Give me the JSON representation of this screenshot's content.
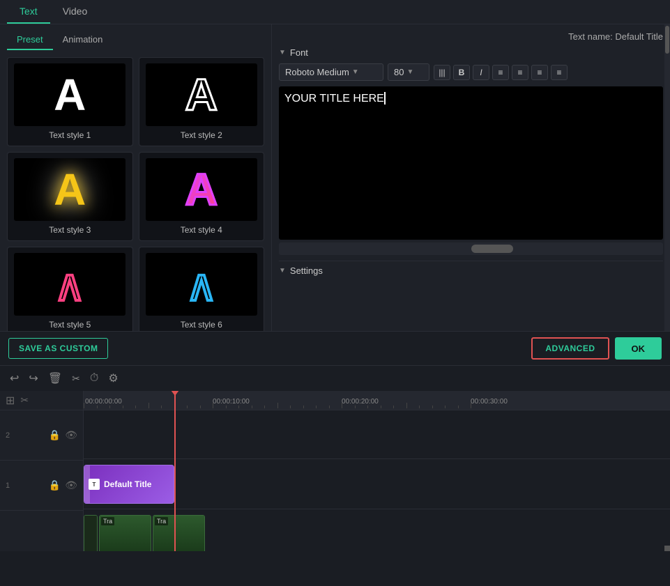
{
  "tabs": {
    "top": [
      {
        "id": "text",
        "label": "Text",
        "active": true
      },
      {
        "id": "video",
        "label": "Video",
        "active": false
      }
    ],
    "sub": [
      {
        "id": "preset",
        "label": "Preset",
        "active": true
      },
      {
        "id": "animation",
        "label": "Animation",
        "active": false
      }
    ]
  },
  "header": {
    "text_name_label": "Text name: Default Title"
  },
  "font": {
    "section_label": "Font",
    "font_name": "Roboto Medium",
    "font_size": "80",
    "format_buttons": [
      "|||",
      "B",
      "I",
      "≡",
      "≡",
      "≡",
      "≡"
    ]
  },
  "text_content": "YOUR TITLE HERE",
  "settings": {
    "section_label": "Settings"
  },
  "styles": [
    {
      "id": "style1",
      "label": "Text style 1",
      "type": "solid-white"
    },
    {
      "id": "style2",
      "label": "Text style 2",
      "type": "outline-white"
    },
    {
      "id": "style3",
      "label": "Text style 3",
      "type": "glow-yellow"
    },
    {
      "id": "style4",
      "label": "Text style 4",
      "type": "outline-pink"
    },
    {
      "id": "style5",
      "label": "Text style 5",
      "type": "arch-pink"
    },
    {
      "id": "style6",
      "label": "Text style 6",
      "type": "arch-blue"
    }
  ],
  "actions": {
    "save_custom": "SAVE AS CUSTOM",
    "advanced": "ADVANCED",
    "ok": "OK"
  },
  "timeline": {
    "toolbar_icons": [
      "undo",
      "redo",
      "delete",
      "scissors",
      "clock",
      "settings"
    ],
    "times": [
      "00:00:00:00",
      "00:00:10:00",
      "00:00:20:00",
      "00:00:30:00"
    ],
    "tracks": [
      {
        "id": 2,
        "clips": [
          {
            "type": "text",
            "label": "Default Title"
          }
        ]
      },
      {
        "id": 1,
        "clips": [
          {
            "type": "video",
            "label": "Tra"
          },
          {
            "type": "video",
            "label": "Tra"
          }
        ]
      }
    ]
  }
}
